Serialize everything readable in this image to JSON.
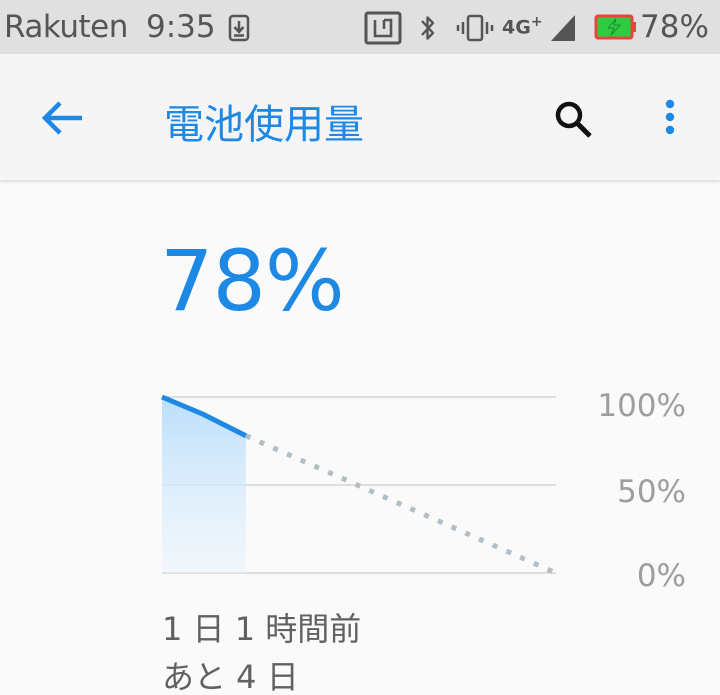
{
  "status_bar": {
    "carrier": "Rakuten",
    "time": "9:35",
    "network": "4G",
    "network_sup": "+",
    "battery_percent": "78%",
    "icons": [
      "download-icon",
      "nfc-icon",
      "bluetooth-icon",
      "vibrate-icon",
      "signal-icon",
      "battery-charging-icon"
    ]
  },
  "app_bar": {
    "title": "電池使用量",
    "back_icon": "arrow-back-icon",
    "search_icon": "search-icon",
    "more_icon": "more-vert-icon"
  },
  "battery": {
    "level_text": "78%",
    "level": 78
  },
  "chart_data": {
    "type": "line",
    "ylim": [
      0,
      100
    ],
    "ytick_labels": [
      "100%",
      "50%",
      "0%"
    ],
    "series": [
      {
        "style": "solid",
        "x": [
          0,
          0.5,
          1
        ],
        "y": [
          100,
          90,
          78
        ]
      },
      {
        "style": "dotted",
        "x": [
          1,
          4.7
        ],
        "y": [
          78,
          0
        ]
      }
    ],
    "grid": true
  },
  "footer": {
    "time_ago": "1 日 1 時間前",
    "time_remaining": "あと 4 日"
  },
  "colors": {
    "accent": "#1e88e5",
    "status_bar_bg": "#e0e0e0",
    "battery_fill": "#2ecc40",
    "battery_border": "#e8453c"
  }
}
